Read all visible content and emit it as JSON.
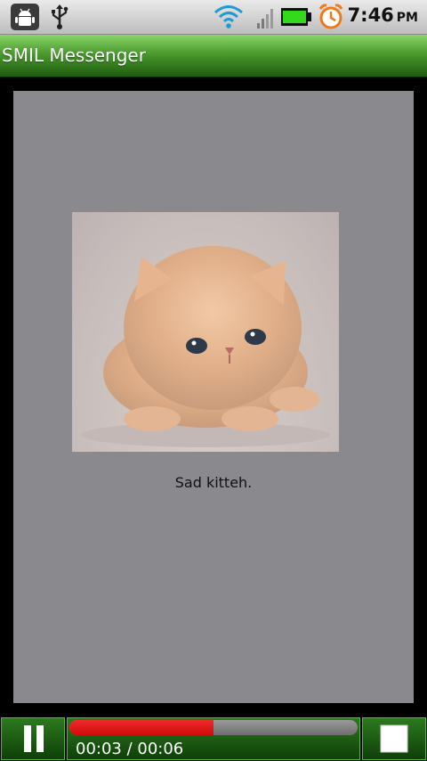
{
  "status_bar": {
    "icons": [
      "android-debug-icon",
      "usb-icon",
      "wifi-icon",
      "signal-icon",
      "battery-icon",
      "alarm-icon"
    ],
    "time": "7:46",
    "ampm": "PM"
  },
  "app": {
    "title": "SMIL Messenger"
  },
  "slide": {
    "image": "kitten-photo",
    "caption": "Sad kitteh."
  },
  "player": {
    "progress_fraction": 0.5,
    "time_text": "00:03 / 00:06",
    "colors": {
      "progress_fill": "#d10b0b",
      "progress_track": "#8a8a8a",
      "button_green": "#1f6a12"
    }
  },
  "colors": {
    "slide_background": "#8a898e",
    "title_bar_green": "#4a9a2e"
  }
}
